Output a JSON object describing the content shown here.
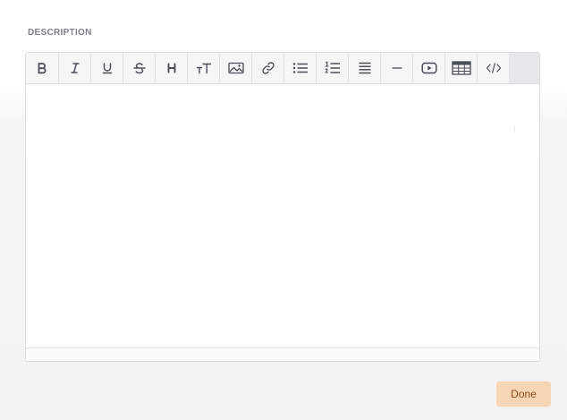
{
  "section": {
    "label": "DESCRIPTION"
  },
  "toolbar": {
    "tools": [
      {
        "name": "bold",
        "icon": "bold-icon",
        "glyph": "B"
      },
      {
        "name": "italic",
        "icon": "italic-icon",
        "glyph": "I"
      },
      {
        "name": "underline",
        "icon": "underline-icon",
        "glyph": "U"
      },
      {
        "name": "strikethrough",
        "icon": "strikethrough-icon",
        "glyph": "S"
      },
      {
        "name": "heading",
        "icon": "heading-icon",
        "glyph": "H"
      },
      {
        "name": "font-size",
        "icon": "font-size-icon",
        "glyph": "TT"
      },
      {
        "name": "image",
        "icon": "image-icon"
      },
      {
        "name": "link",
        "icon": "link-icon"
      },
      {
        "name": "bulleted-list",
        "icon": "bulleted-list-icon"
      },
      {
        "name": "numbered-list",
        "icon": "numbered-list-icon"
      },
      {
        "name": "align",
        "icon": "align-justify-icon"
      },
      {
        "name": "horizontal-rule",
        "icon": "horizontal-rule-icon"
      },
      {
        "name": "video",
        "icon": "video-icon"
      },
      {
        "name": "table",
        "icon": "table-icon"
      },
      {
        "name": "code",
        "icon": "code-icon"
      }
    ]
  },
  "editor": {
    "content": ""
  },
  "actions": {
    "done_label": "Done"
  },
  "colors": {
    "label": "#7c8189",
    "button_bg": "#f7d6b5",
    "button_text": "#8a4a18",
    "toolbar_bg": "#f6f6f7"
  }
}
